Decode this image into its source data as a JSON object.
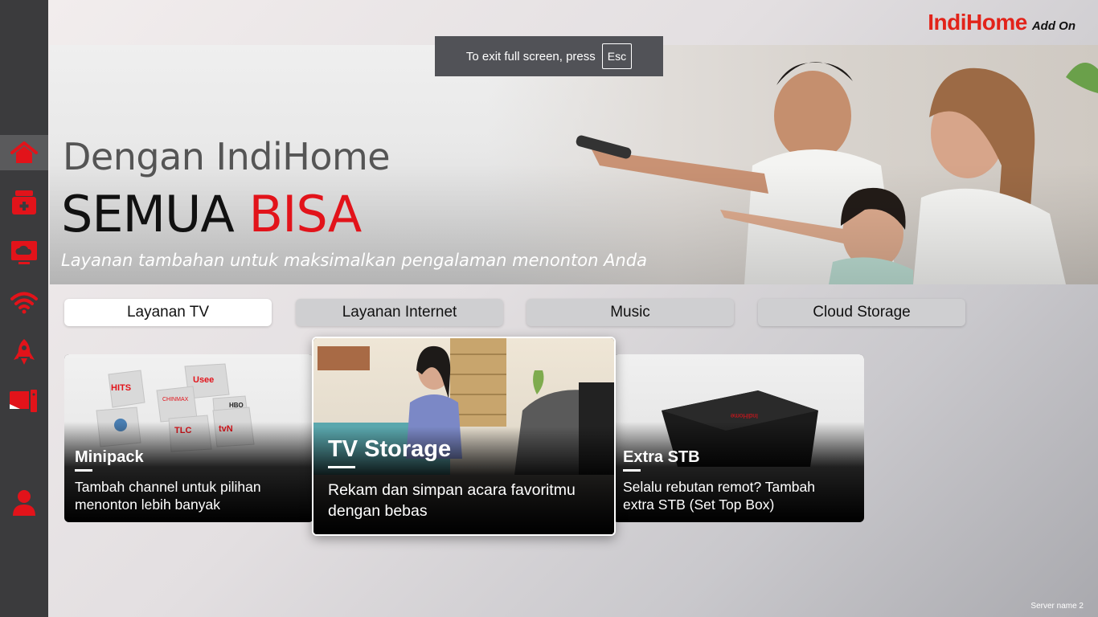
{
  "logo": {
    "brand": "IndiHome",
    "addon": "Add On"
  },
  "toast": {
    "text": "To exit full screen, press",
    "key": "Esc"
  },
  "sidebar": {
    "items": [
      {
        "icon": "home-icon"
      },
      {
        "icon": "first-aid-box-icon"
      },
      {
        "icon": "cloud-screen-icon"
      },
      {
        "icon": "wifi-icon"
      },
      {
        "icon": "rocket-icon"
      },
      {
        "icon": "devices-icon"
      },
      {
        "icon": "user-icon"
      }
    ]
  },
  "hero": {
    "heading": "Dengan IndiHome",
    "title_black": "SEMUA ",
    "title_red": "BISA",
    "subtitle": "Layanan tambahan untuk maksimalkan pengalaman menonton Anda"
  },
  "tabs": [
    {
      "label": "Layanan TV",
      "active": true
    },
    {
      "label": "Layanan Internet",
      "active": false
    },
    {
      "label": "Music",
      "active": false
    },
    {
      "label": "Cloud Storage",
      "active": false
    }
  ],
  "cards": [
    {
      "title": "Minipack",
      "desc": "Tambah channel untuk pilihan menonton lebih banyak"
    },
    {
      "title": "TV Storage",
      "desc": "Rekam dan simpan acara favoritmu dengan bebas"
    },
    {
      "title": "Extra STB",
      "desc": "Selalu rebutan remot? Tambah extra STB (Set Top Box)"
    }
  ],
  "footer": {
    "server": "Server name 2"
  },
  "colors": {
    "accent": "#e2131a",
    "sidebar": "#3b3b3d"
  }
}
